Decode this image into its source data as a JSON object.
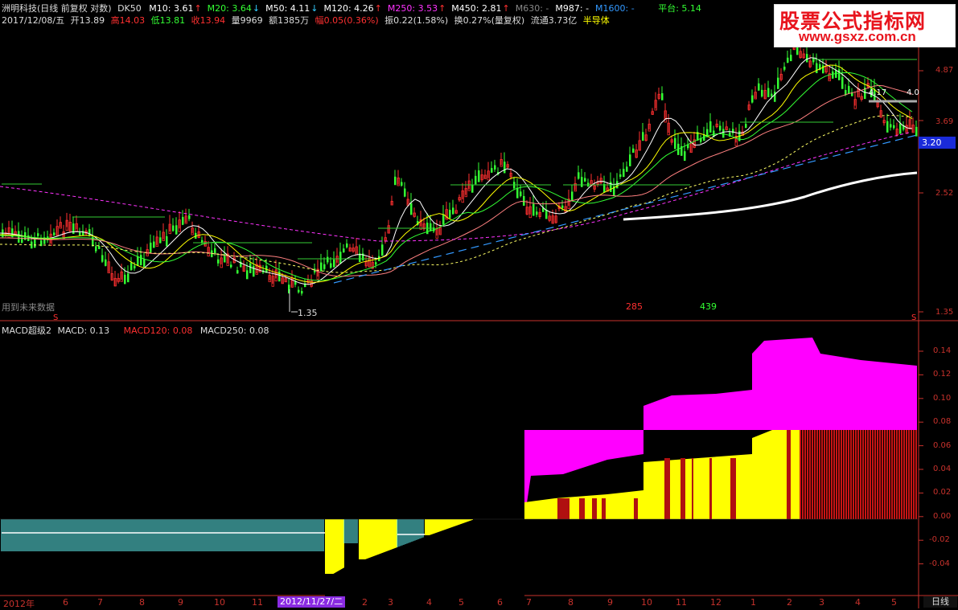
{
  "header": {
    "stock_name": "洲明科技",
    "period_info": "(日线 前复权 对数)",
    "indicator": "DK50",
    "ma": [
      {
        "label": "M10: 3.61",
        "arrow": "↑",
        "color": "#ffffff",
        "arrow_color": "#ff3030"
      },
      {
        "label": "M20: 3.64",
        "arrow": "↓",
        "color": "#33ff33",
        "arrow_color": "#33ccff"
      },
      {
        "label": "M50: 4.11",
        "arrow": "↓",
        "color": "#ffffff",
        "arrow_color": "#33ccff"
      },
      {
        "label": "M120: 4.26",
        "arrow": "↑",
        "color": "#ffffff",
        "arrow_color": "#ff3030"
      },
      {
        "label": "M250: 3.53",
        "arrow": "↑",
        "color": "#ff33ff",
        "arrow_color": "#ff3030"
      },
      {
        "label": "M450: 2.81",
        "arrow": "↑",
        "color": "#ffffff",
        "arrow_color": "#ff3030"
      },
      {
        "label": "M630: -",
        "arrow": "",
        "color": "#888888",
        "arrow_color": "#888888"
      },
      {
        "label": "M987: -",
        "arrow": "",
        "color": "#ffffff",
        "arrow_color": "#888888"
      },
      {
        "label": "M1600: -",
        "arrow": "",
        "color": "#3399ff",
        "arrow_color": "#888888"
      }
    ],
    "platform": "平台: 5.14"
  },
  "quote": {
    "date": "2017/12/08/五",
    "open": "开13.89",
    "high": "高14.03",
    "low": "低13.81",
    "close": "收13.94",
    "volume": "量9969",
    "amount": "额1385万",
    "change": "幅0.05(0.36%)",
    "amplitude": "振0.22(1.58%)",
    "turnover": "换0.27%(量复权)",
    "float_cap": "流通3.73亿",
    "sector": "半导体"
  },
  "logo": {
    "title": "股票公式指标网",
    "url": "www.gsxz.com.cn"
  },
  "price_axis": {
    "ticks": [
      "4.87",
      "3.69",
      "2.52",
      "1.35"
    ],
    "current": "3.20"
  },
  "annotations": {
    "future_data": "用到未来数据",
    "low_mark": "1.35",
    "count_a": "285",
    "count_b": "439",
    "s_marker": "S",
    "label_top_right": "4.17",
    "label_top_right_b": "4.0"
  },
  "macd": {
    "title": "MACD超级2",
    "macd": "MACD: 0.13",
    "macd120": "MACD120: 0.08",
    "macd250": "MACD250: 0.08",
    "ticks": [
      "0.14",
      "0.12",
      "0.10",
      "0.08",
      "0.06",
      "0.04",
      "0.02",
      "0.00",
      "-0.02",
      "-0.04"
    ]
  },
  "time_axis": {
    "labels": [
      "2012年",
      "6",
      "7",
      "8",
      "9",
      "10",
      "11",
      "2012/11/27/二",
      "2",
      "3",
      "4",
      "5",
      "6",
      "7",
      "8",
      "9",
      "10",
      "11",
      "12",
      "1",
      "2",
      "3",
      "4",
      "5"
    ],
    "period": "日线"
  },
  "colors": {
    "up": "#ff3030",
    "down": "#33ff33",
    "magenta": "#ff00ff",
    "yellow": "#ffff00",
    "cyan": "#66ffff",
    "darkred": "#b01010",
    "axis": "#c8322c",
    "tag": "#1a2bd9"
  }
}
